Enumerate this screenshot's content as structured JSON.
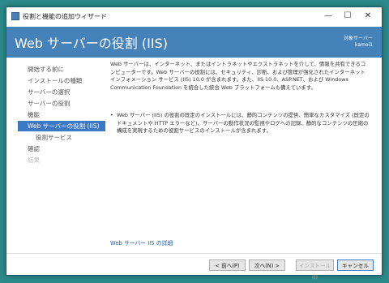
{
  "window": {
    "title": "役割と機能の追加ウィザード",
    "minimize_glyph": "—",
    "maximize_glyph": "☐",
    "close_glyph": "✕"
  },
  "header": {
    "title": "Web サーバーの役割 (IIS)",
    "server_label": "対象サーバー",
    "server_name": "kamoi1"
  },
  "nav": {
    "items": [
      {
        "label": "開始する前に"
      },
      {
        "label": "インストールの種類"
      },
      {
        "label": "サーバーの選択"
      },
      {
        "label": "サーバーの役割"
      },
      {
        "label": "機能"
      },
      {
        "label": "Web サーバーの役割 (IIS)"
      },
      {
        "label": "役割サービス"
      },
      {
        "label": "確認"
      },
      {
        "label": "結果"
      }
    ]
  },
  "content": {
    "intro": "Web サーバーは、インターネット、またはイントラネットやエクストラネットを介して、情報を共有できるコンピューターです。Web サーバーの役割には、セキュリティ、診断、および管理が強化されたインターネット インフォメーション サービス (IIS) 10.0 が含まれます。また、IIS 10.0、ASP.NET、および Windows Communication Foundation を統合した統合 Web プラットフォームも備えています。",
    "bullet": "Web サーバー (IIS) の役割の既定のインストールには、静的コンテンツの提供、簡単なカスタマイズ (既定のドキュメントや HTTP エラーなど)、サーバーの動作状況の監視やログへの記録、静的なコンテンツの圧縮の構成を実現するための役割サービスのインストールが含まれます。",
    "link": "Web サーバー IIS の詳細"
  },
  "footer": {
    "prev": "< 前へ(P)",
    "next": "次へ(N) >",
    "install": "インストール(I)",
    "cancel": "キャンセル"
  }
}
